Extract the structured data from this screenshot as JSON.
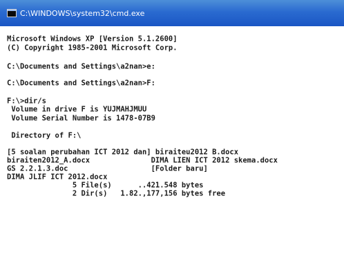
{
  "window": {
    "title": "C:\\WINDOWS\\system32\\cmd.exe",
    "title_icon": "console-icon"
  },
  "console": {
    "lines": [
      "Microsoft Windows XP [Version 5.1.2600]",
      "(C) Copyright 1985-2001 Microsoft Corp.",
      "",
      "C:\\Documents and Settings\\a2nan>e:",
      "",
      "C:\\Documents and Settings\\a2nan>F:",
      "",
      "F:\\>dir/s",
      " Volume in drive F is YUJMAHJMUU",
      " Volume Serial Number is 1478-07B9",
      "",
      " Directory of F:\\",
      "",
      "[5 soalan perubahan ICT 2012 dan] biraiteu2012 B.docx",
      "biraiten2012_A.docx              DIMA LIEN ICT 2012 skema.docx",
      "GS 2.2.1.3.doc                   [Folder baru]",
      "DIMA JLIF ICT 2012.docx",
      "               5 File(s)      ..421.548 bytes",
      "               2 Dir(s)   1.82.,177,156 bytes free"
    ]
  }
}
